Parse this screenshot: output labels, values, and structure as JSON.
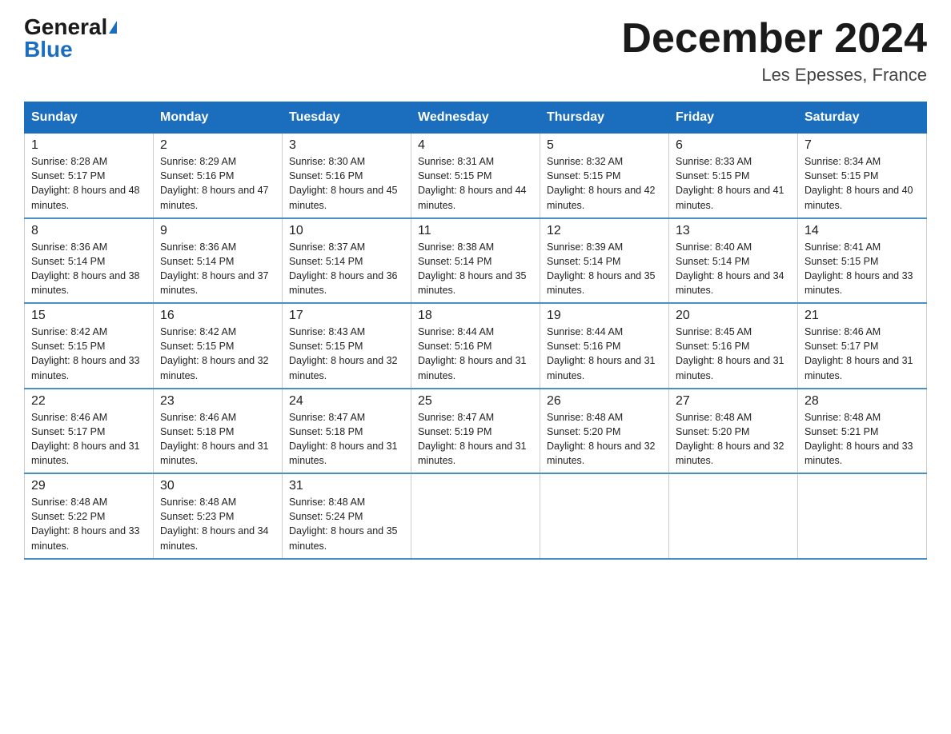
{
  "header": {
    "logo_general": "General",
    "logo_blue": "Blue",
    "month_title": "December 2024",
    "location": "Les Epesses, France"
  },
  "weekdays": [
    "Sunday",
    "Monday",
    "Tuesday",
    "Wednesday",
    "Thursday",
    "Friday",
    "Saturday"
  ],
  "weeks": [
    [
      {
        "day": "1",
        "sunrise": "8:28 AM",
        "sunset": "5:17 PM",
        "daylight": "8 hours and 48 minutes."
      },
      {
        "day": "2",
        "sunrise": "8:29 AM",
        "sunset": "5:16 PM",
        "daylight": "8 hours and 47 minutes."
      },
      {
        "day": "3",
        "sunrise": "8:30 AM",
        "sunset": "5:16 PM",
        "daylight": "8 hours and 45 minutes."
      },
      {
        "day": "4",
        "sunrise": "8:31 AM",
        "sunset": "5:15 PM",
        "daylight": "8 hours and 44 minutes."
      },
      {
        "day": "5",
        "sunrise": "8:32 AM",
        "sunset": "5:15 PM",
        "daylight": "8 hours and 42 minutes."
      },
      {
        "day": "6",
        "sunrise": "8:33 AM",
        "sunset": "5:15 PM",
        "daylight": "8 hours and 41 minutes."
      },
      {
        "day": "7",
        "sunrise": "8:34 AM",
        "sunset": "5:15 PM",
        "daylight": "8 hours and 40 minutes."
      }
    ],
    [
      {
        "day": "8",
        "sunrise": "8:36 AM",
        "sunset": "5:14 PM",
        "daylight": "8 hours and 38 minutes."
      },
      {
        "day": "9",
        "sunrise": "8:36 AM",
        "sunset": "5:14 PM",
        "daylight": "8 hours and 37 minutes."
      },
      {
        "day": "10",
        "sunrise": "8:37 AM",
        "sunset": "5:14 PM",
        "daylight": "8 hours and 36 minutes."
      },
      {
        "day": "11",
        "sunrise": "8:38 AM",
        "sunset": "5:14 PM",
        "daylight": "8 hours and 35 minutes."
      },
      {
        "day": "12",
        "sunrise": "8:39 AM",
        "sunset": "5:14 PM",
        "daylight": "8 hours and 35 minutes."
      },
      {
        "day": "13",
        "sunrise": "8:40 AM",
        "sunset": "5:14 PM",
        "daylight": "8 hours and 34 minutes."
      },
      {
        "day": "14",
        "sunrise": "8:41 AM",
        "sunset": "5:15 PM",
        "daylight": "8 hours and 33 minutes."
      }
    ],
    [
      {
        "day": "15",
        "sunrise": "8:42 AM",
        "sunset": "5:15 PM",
        "daylight": "8 hours and 33 minutes."
      },
      {
        "day": "16",
        "sunrise": "8:42 AM",
        "sunset": "5:15 PM",
        "daylight": "8 hours and 32 minutes."
      },
      {
        "day": "17",
        "sunrise": "8:43 AM",
        "sunset": "5:15 PM",
        "daylight": "8 hours and 32 minutes."
      },
      {
        "day": "18",
        "sunrise": "8:44 AM",
        "sunset": "5:16 PM",
        "daylight": "8 hours and 31 minutes."
      },
      {
        "day": "19",
        "sunrise": "8:44 AM",
        "sunset": "5:16 PM",
        "daylight": "8 hours and 31 minutes."
      },
      {
        "day": "20",
        "sunrise": "8:45 AM",
        "sunset": "5:16 PM",
        "daylight": "8 hours and 31 minutes."
      },
      {
        "day": "21",
        "sunrise": "8:46 AM",
        "sunset": "5:17 PM",
        "daylight": "8 hours and 31 minutes."
      }
    ],
    [
      {
        "day": "22",
        "sunrise": "8:46 AM",
        "sunset": "5:17 PM",
        "daylight": "8 hours and 31 minutes."
      },
      {
        "day": "23",
        "sunrise": "8:46 AM",
        "sunset": "5:18 PM",
        "daylight": "8 hours and 31 minutes."
      },
      {
        "day": "24",
        "sunrise": "8:47 AM",
        "sunset": "5:18 PM",
        "daylight": "8 hours and 31 minutes."
      },
      {
        "day": "25",
        "sunrise": "8:47 AM",
        "sunset": "5:19 PM",
        "daylight": "8 hours and 31 minutes."
      },
      {
        "day": "26",
        "sunrise": "8:48 AM",
        "sunset": "5:20 PM",
        "daylight": "8 hours and 32 minutes."
      },
      {
        "day": "27",
        "sunrise": "8:48 AM",
        "sunset": "5:20 PM",
        "daylight": "8 hours and 32 minutes."
      },
      {
        "day": "28",
        "sunrise": "8:48 AM",
        "sunset": "5:21 PM",
        "daylight": "8 hours and 33 minutes."
      }
    ],
    [
      {
        "day": "29",
        "sunrise": "8:48 AM",
        "sunset": "5:22 PM",
        "daylight": "8 hours and 33 minutes."
      },
      {
        "day": "30",
        "sunrise": "8:48 AM",
        "sunset": "5:23 PM",
        "daylight": "8 hours and 34 minutes."
      },
      {
        "day": "31",
        "sunrise": "8:48 AM",
        "sunset": "5:24 PM",
        "daylight": "8 hours and 35 minutes."
      },
      null,
      null,
      null,
      null
    ]
  ]
}
